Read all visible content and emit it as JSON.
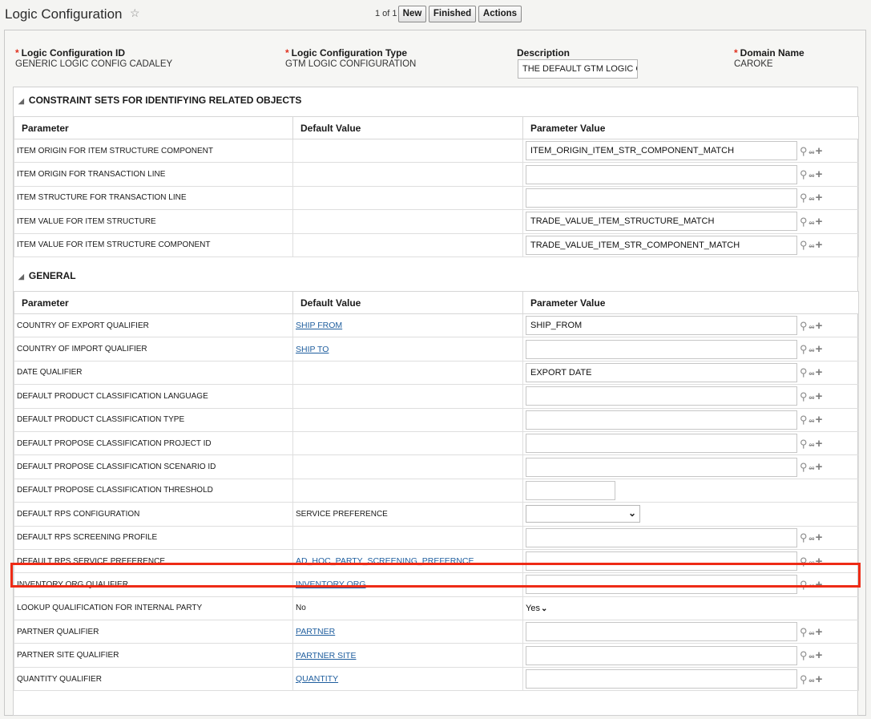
{
  "header": {
    "title": "Logic Configuration",
    "star": "☆",
    "pager": "1 of 1",
    "buttons": {
      "new": "New",
      "finished": "Finished",
      "actions": "Actions"
    }
  },
  "fields": {
    "id_label": "Logic Configuration ID",
    "id_value": "GENERIC LOGIC CONFIG CADALEY",
    "type_label": "Logic Configuration Type",
    "type_value": "GTM LOGIC CONFIGURATION",
    "desc_label": "Description",
    "desc_value": "THE DEFAULT GTM LOGIC C",
    "domain_label": "Domain Name",
    "domain_value": "CAROKE",
    "required_mark": "*"
  },
  "columns": {
    "parameter": "Parameter",
    "default": "Default Value",
    "value": "Parameter Value"
  },
  "sections": [
    {
      "title": "CONSTRAINT SETS FOR IDENTIFYING RELATED OBJECTS",
      "rows": [
        {
          "param": "ITEM ORIGIN FOR ITEM STRUCTURE COMPONENT",
          "default": "",
          "value": "ITEM_ORIGIN_ITEM_STR_COMPONENT_MATCH"
        },
        {
          "param": "ITEM ORIGIN FOR TRANSACTION LINE",
          "default": "",
          "value": ""
        },
        {
          "param": "ITEM STRUCTURE FOR TRANSACTION LINE",
          "default": "",
          "value": ""
        },
        {
          "param": "ITEM VALUE FOR ITEM STRUCTURE",
          "default": "",
          "value": "TRADE_VALUE_ITEM_STRUCTURE_MATCH"
        },
        {
          "param": "ITEM VALUE FOR ITEM STRUCTURE COMPONENT",
          "default": "",
          "value": "TRADE_VALUE_ITEM_STR_COMPONENT_MATCH"
        }
      ]
    },
    {
      "title": "GENERAL",
      "rows": [
        {
          "param": "COUNTRY OF EXPORT QUALIFIER",
          "default": "SHIP FROM",
          "value": "SHIP_FROM"
        },
        {
          "param": "COUNTRY OF IMPORT QUALIFIER",
          "default": "SHIP TO",
          "value": ""
        },
        {
          "param": "DATE QUALIFIER",
          "default": "",
          "value": "EXPORT DATE"
        },
        {
          "param": "DEFAULT PRODUCT CLASSIFICATION LANGUAGE",
          "default": "",
          "value": ""
        },
        {
          "param": "DEFAULT PRODUCT CLASSIFICATION TYPE",
          "default": "",
          "value": ""
        },
        {
          "param": "DEFAULT PROPOSE CLASSIFICATION PROJECT ID",
          "default": "",
          "value": ""
        },
        {
          "param": "DEFAULT PROPOSE CLASSIFICATION SCENARIO ID",
          "default": "",
          "value": ""
        },
        {
          "param": "DEFAULT PROPOSE CLASSIFICATION THRESHOLD",
          "default": "",
          "value": ""
        },
        {
          "param": "DEFAULT RPS CONFIGURATION",
          "default": "SERVICE PREFERENCE",
          "value": ""
        },
        {
          "param": "DEFAULT RPS SCREENING PROFILE",
          "default": "",
          "value": ""
        },
        {
          "param": "DEFAULT RPS SERVICE PREFERENCE",
          "default": "AD_HOC_PARTY_SCREENING_PREFERNCE",
          "value": ""
        },
        {
          "param": "INVENTORY ORG QUALIFIER",
          "default": "INVENTORY ORG",
          "value": ""
        },
        {
          "param": "LOOKUP QUALIFICATION FOR INTERNAL PARTY",
          "default": "No",
          "value": "Yes"
        },
        {
          "param": "PARTNER QUALIFIER",
          "default": "PARTNER",
          "value": ""
        },
        {
          "param": "PARTNER SITE QUALIFIER",
          "default": "PARTNER SITE",
          "value": ""
        },
        {
          "param": "QUANTITY QUALIFIER",
          "default": "QUANTITY",
          "value": ""
        }
      ]
    }
  ],
  "icons": {
    "search": "search-icon",
    "link": "link-icon",
    "add": "add-icon"
  },
  "colors": {
    "highlight": "#ee2b16",
    "link": "#1f5e9e",
    "required": "#e0301e"
  }
}
